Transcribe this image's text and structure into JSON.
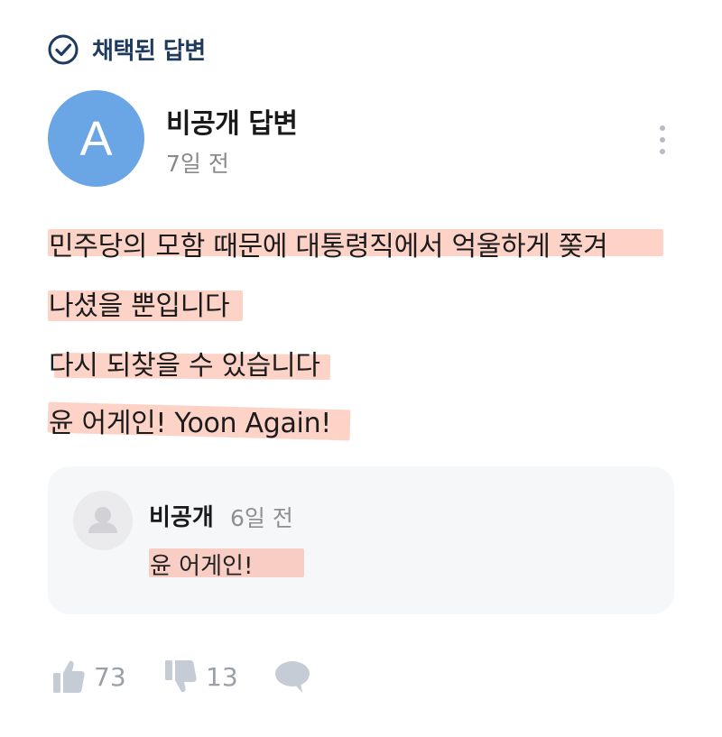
{
  "adopted": {
    "label": "채택된 답변",
    "color": "#1f3a5f",
    "icon": "check-circle-icon"
  },
  "author": {
    "avatar_letter": "A",
    "avatar_color": "#6aa6e6",
    "name": "비공개 답변",
    "time": "7일 전"
  },
  "answer": {
    "lines": [
      "민주당의 모함 때문에 대통령직에서 억울하게 쫒겨",
      "나셨을 뿐입니다",
      "다시 되찾을 수 있습니다",
      "윤 어게인!  Yoon Again!"
    ],
    "highlight_color": "#f8a08a"
  },
  "reply": {
    "name": "비공개",
    "time": "6일 전",
    "text": "윤 어게인!",
    "avatar_icon": "user-silhouette-icon"
  },
  "actions": {
    "like_count": "73",
    "dislike_count": "13",
    "like_icon": "thumbs-up-icon",
    "dislike_icon": "thumbs-down-icon",
    "comment_icon": "comment-bubble-icon"
  }
}
